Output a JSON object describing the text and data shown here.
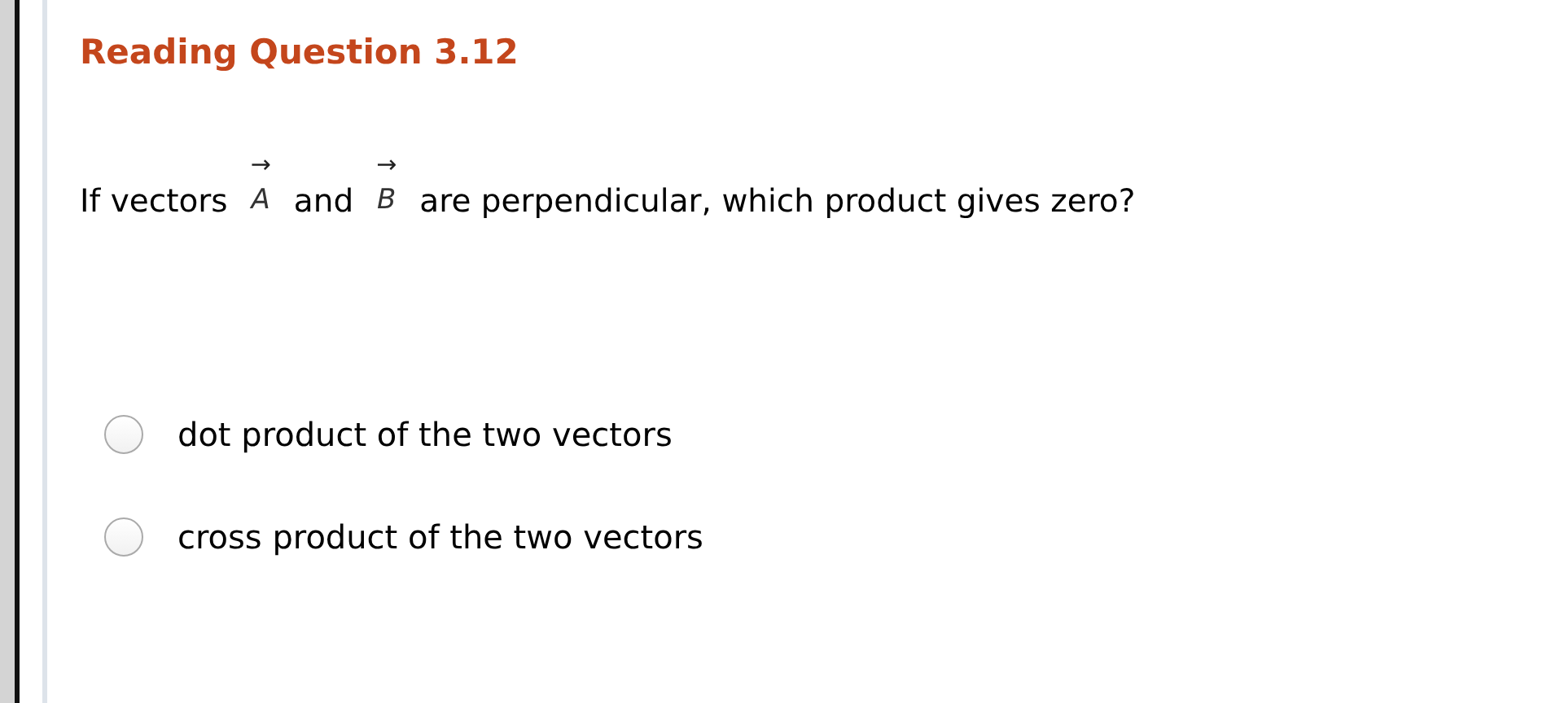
{
  "title": "Reading Question 3.12",
  "question": [
    {
      "kind": "text",
      "text": "If vectors"
    },
    {
      "kind": "vector",
      "arrow": "→",
      "symbol": "A"
    },
    {
      "kind": "text",
      "text": "and"
    },
    {
      "kind": "vector",
      "arrow": "→",
      "symbol": "B"
    },
    {
      "kind": "text",
      "text": "are perpendicular, which product gives zero?"
    }
  ],
  "options": [
    {
      "label": "dot product of the two vectors",
      "selected": false
    },
    {
      "label": "cross product of the two vectors",
      "selected": false
    }
  ]
}
